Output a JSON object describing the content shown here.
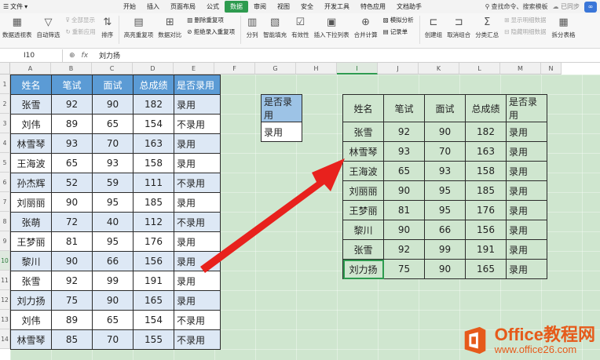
{
  "menu": {
    "file_label": "文件",
    "items": [
      "开始",
      "插入",
      "页面布局",
      "公式",
      "数据",
      "审阅",
      "视图",
      "安全",
      "开发工具",
      "特色应用",
      "文档助手"
    ],
    "active": "数据",
    "search_label": "查找命令、搜索模板",
    "sync_label": "已同步"
  },
  "ribbon": {
    "pivot": "数据透视表",
    "autofilter": "自动筛选",
    "show_all": "全部显示",
    "reapply": "重新应用",
    "sort": "排序",
    "highlight_dup": "高亮重复项",
    "data_compare": "数据对比",
    "remove_dup": "删除重复项",
    "reject_dup": "拒绝录入重复项",
    "split": "分列",
    "smart_fill": "智能填充",
    "validity": "有效性",
    "insert_dropdown": "插入下拉列表",
    "merge_calc": "合并计算",
    "simulate": "模拟分析",
    "record": "记录单",
    "create_group": "创建组",
    "ungroup": "取消组合",
    "subtotal": "分类汇总",
    "show_detail": "显示明细数据",
    "hide_detail": "隐藏明细数据",
    "split_table": "拆分表格"
  },
  "formula_bar": {
    "cell_ref": "I10",
    "value": "刘力扬"
  },
  "columns": [
    "A",
    "B",
    "C",
    "D",
    "E",
    "F",
    "G",
    "H",
    "I",
    "J",
    "K",
    "L",
    "M",
    "N"
  ],
  "selected_column": "I",
  "rows": [
    "1",
    "2",
    "3",
    "4",
    "5",
    "6",
    "7",
    "8",
    "9",
    "10",
    "11",
    "12",
    "13",
    "14"
  ],
  "selected_row": "10",
  "left_table": {
    "headers": [
      "姓名",
      "笔试",
      "面试",
      "总成绩",
      "是否录用"
    ],
    "rows": [
      [
        "张雪",
        "92",
        "90",
        "182",
        "录用"
      ],
      [
        "刘伟",
        "89",
        "65",
        "154",
        "不录用"
      ],
      [
        "林雪琴",
        "93",
        "70",
        "163",
        "录用"
      ],
      [
        "王海波",
        "65",
        "93",
        "158",
        "录用"
      ],
      [
        "孙杰辉",
        "52",
        "59",
        "111",
        "不录用"
      ],
      [
        "刘丽丽",
        "90",
        "95",
        "185",
        "录用"
      ],
      [
        "张萌",
        "72",
        "40",
        "112",
        "不录用"
      ],
      [
        "王梦丽",
        "81",
        "95",
        "176",
        "录用"
      ],
      [
        "黎川",
        "90",
        "66",
        "156",
        "录用"
      ],
      [
        "张雪",
        "92",
        "99",
        "191",
        "录用"
      ],
      [
        "刘力扬",
        "75",
        "90",
        "165",
        "录用"
      ],
      [
        "刘伟",
        "89",
        "65",
        "154",
        "不录用"
      ],
      [
        "林雪琴",
        "85",
        "70",
        "155",
        "不录用"
      ]
    ]
  },
  "criteria_table": {
    "header": "是否录用",
    "value": "录用"
  },
  "result_table": {
    "headers": [
      "姓名",
      "笔试",
      "面试",
      "总成绩",
      "是否录用"
    ],
    "rows": [
      [
        "张雪",
        "92",
        "90",
        "182",
        "录用"
      ],
      [
        "林雪琴",
        "93",
        "70",
        "163",
        "录用"
      ],
      [
        "王海波",
        "65",
        "93",
        "158",
        "录用"
      ],
      [
        "刘丽丽",
        "90",
        "95",
        "185",
        "录用"
      ],
      [
        "王梦丽",
        "81",
        "95",
        "176",
        "录用"
      ],
      [
        "黎川",
        "90",
        "66",
        "156",
        "录用"
      ],
      [
        "张雪",
        "92",
        "99",
        "191",
        "录用"
      ],
      [
        "刘力扬",
        "75",
        "90",
        "165",
        "录用"
      ]
    ]
  },
  "watermark": {
    "title": "Office教程网",
    "url": "www.office26.com"
  },
  "colors": {
    "sheet_bg": "#cfe6cf",
    "header_blue": "#5b9bd5",
    "band_blue": "#dde8f5",
    "accent_green": "#2e9b4f",
    "arrow_red": "#e8211d"
  }
}
